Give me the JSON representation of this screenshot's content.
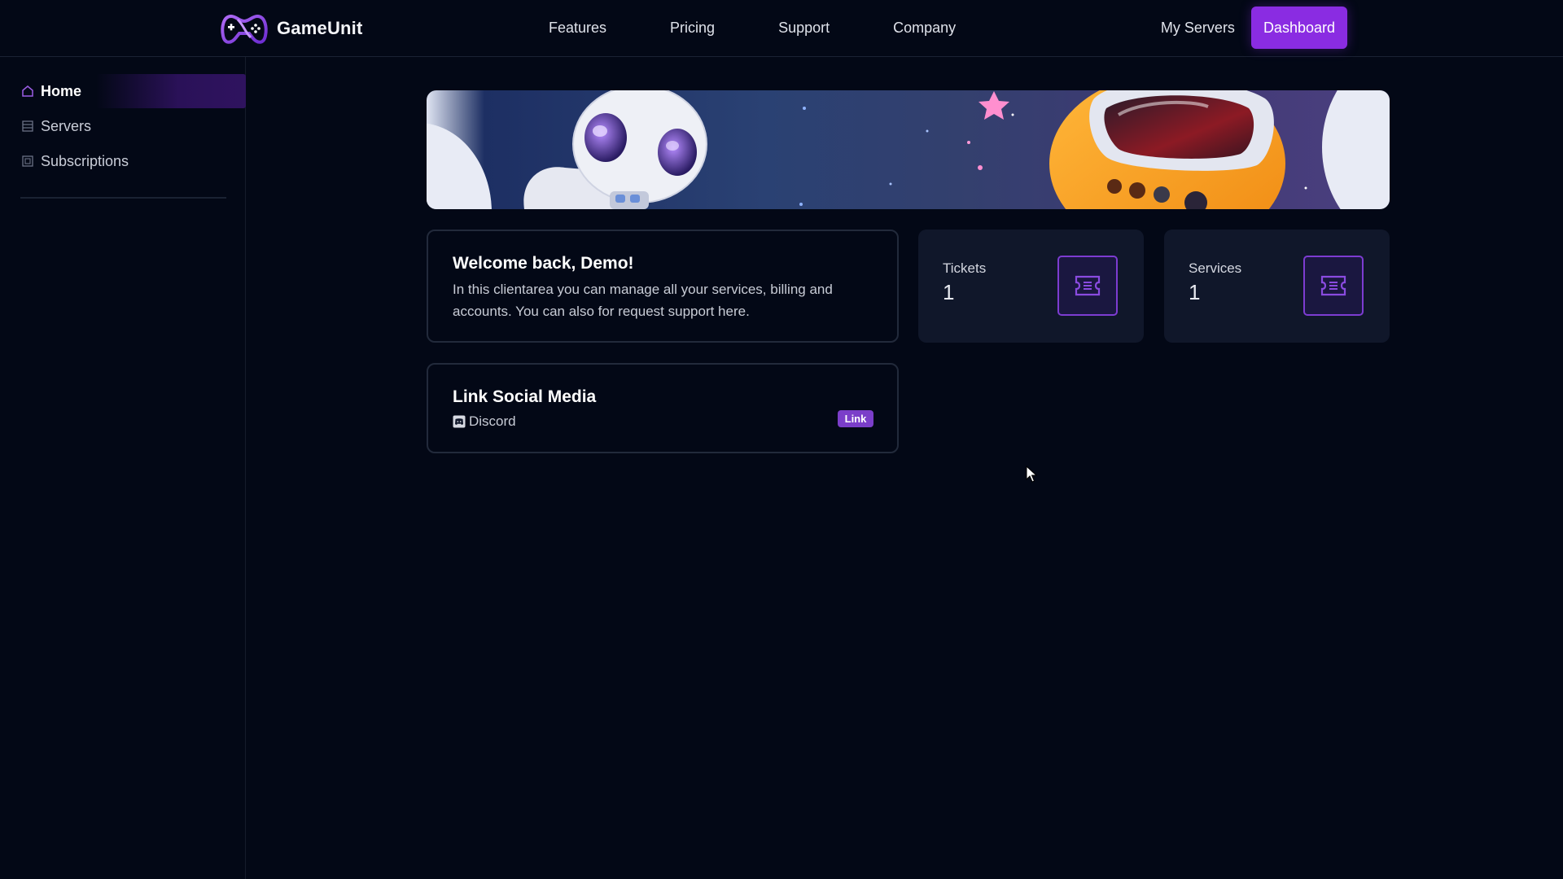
{
  "header": {
    "brand_name": "GameUnit",
    "nav": [
      {
        "label": "Features"
      },
      {
        "label": "Pricing"
      },
      {
        "label": "Support"
      },
      {
        "label": "Company"
      }
    ],
    "my_servers_label": "My Servers",
    "dashboard_label": "Dashboard"
  },
  "sidebar": {
    "items": [
      {
        "label": "Home",
        "icon": "home-icon",
        "active": true
      },
      {
        "label": "Servers",
        "icon": "server-icon",
        "active": false
      },
      {
        "label": "Subscriptions",
        "icon": "subscriptions-icon",
        "active": false
      }
    ]
  },
  "welcome": {
    "title": "Welcome back, Demo!",
    "text": "In this clientarea you can manage all your services, billing and accounts. You can also for request support here."
  },
  "social": {
    "title": "Link Social Media",
    "provider": "Discord",
    "link_label": "Link"
  },
  "stats": {
    "tickets": {
      "label": "Tickets",
      "value": "1",
      "icon": "ticket-icon"
    },
    "services": {
      "label": "Services",
      "value": "1",
      "icon": "ticket-icon"
    }
  },
  "colors": {
    "background": "#030816",
    "accent": "#8a2ce2",
    "card": "#10172a",
    "border": "#222a3b"
  }
}
